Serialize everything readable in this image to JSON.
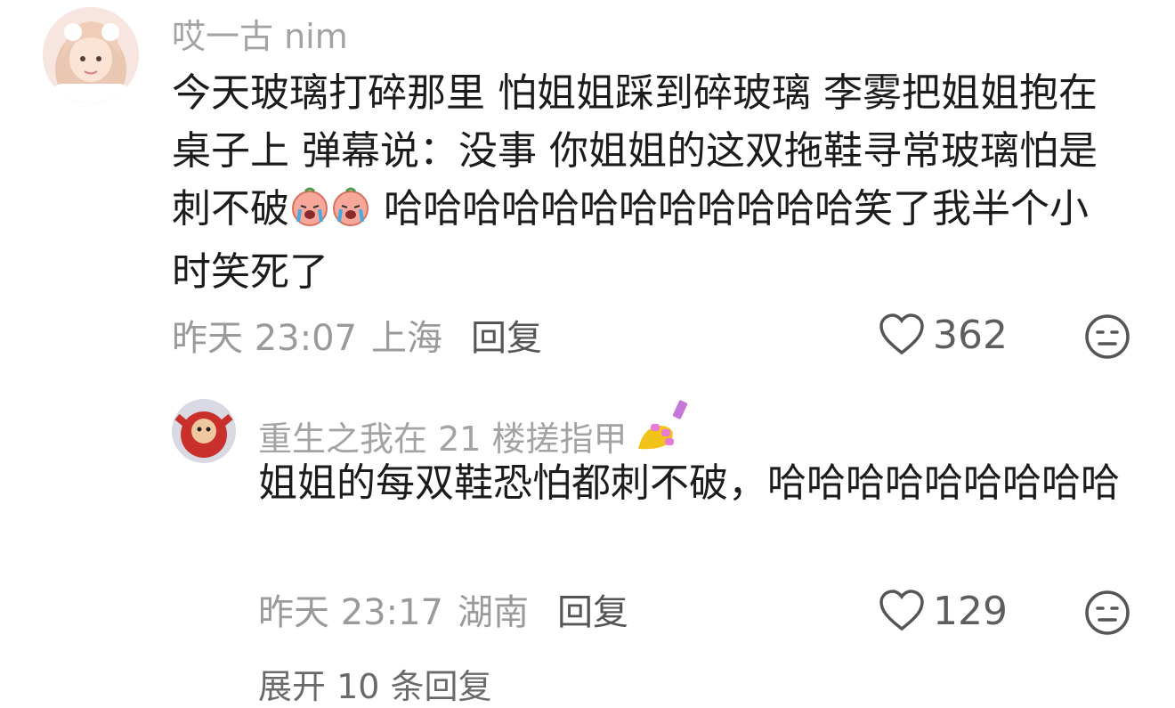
{
  "comments": [
    {
      "username": "哎一古 nim",
      "text_before": "今天玻璃打碎那里 怕姐姐踩到碎玻璃 李雾把姐姐抱在桌子上 弹幕说：没事 你姐姐的这双拖鞋寻常玻璃怕是刺不破",
      "emojis": [
        "crying-face-emoji",
        "crying-face-emoji"
      ],
      "text_after": " 哈哈哈哈哈哈哈哈哈哈哈哈笑了我半个小时笑死了",
      "time": "昨天 23:07",
      "location": "上海",
      "reply_label": "回复",
      "likes": "362"
    }
  ],
  "replies": [
    {
      "username": "重生之我在 21 楼搓指甲",
      "username_emoji": "nail-polish-emoji",
      "text": "姐姐的每双鞋恐怕都刺不破，哈哈哈哈哈哈哈哈哈",
      "time": "昨天 23:17",
      "location": "湖南",
      "reply_label": "回复",
      "likes": "129"
    }
  ],
  "expand_label": "展开 10 条回复",
  "colors": {
    "username": "#a3a3a3",
    "meta": "#9a9a9a",
    "text": "#1c1c1c"
  }
}
